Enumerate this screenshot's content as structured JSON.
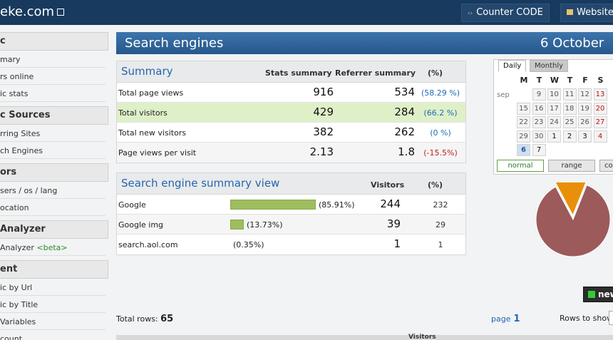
{
  "header": {
    "logo_text": "eke.com",
    "counter_code": "Counter CODE",
    "websites": "Website"
  },
  "sidebar": {
    "sections": [
      {
        "title": "c",
        "items": [
          "mary",
          "rs online",
          "ic stats"
        ]
      },
      {
        "title": "c Sources",
        "items": [
          "rring Sites",
          "ch Engines"
        ]
      },
      {
        "title": "ors",
        "items": [
          "sers / os / lang",
          "ocation"
        ]
      },
      {
        "title": "Analyzer",
        "items": [
          "Analyzer"
        ]
      },
      {
        "title": "ent",
        "items": [
          "ic by Url",
          "ic by Title",
          "Variables",
          "count"
        ]
      }
    ],
    "beta_label": "<beta>"
  },
  "main": {
    "title": "Search engines",
    "date": "6 October"
  },
  "summary": {
    "title": "Summary",
    "col_stats": "Stats summary",
    "col_referrer": "Referrer summary",
    "col_pct": "(%)",
    "rows": [
      {
        "label": "Total page views",
        "stats": "916",
        "referrer": "534",
        "pct": "(58.29 %)"
      },
      {
        "label": "Total visitors",
        "stats": "429",
        "referrer": "284",
        "pct": "(66.2 %)"
      },
      {
        "label": "Total new visitors",
        "stats": "382",
        "referrer": "262",
        "pct": "(0 %)"
      },
      {
        "label": "Page views per visit",
        "stats": "2.13",
        "referrer": "1.8",
        "pct": "(-15.5%)"
      }
    ]
  },
  "engines": {
    "title": "Search engine summary view",
    "col_visitors": "Visitors",
    "col_pct": "(%)",
    "rows": [
      {
        "name": "Google",
        "pct": "(85.91%)",
        "share": 0.8591,
        "visitors": "244",
        "count": "232"
      },
      {
        "name": "Google img",
        "pct": "(13.73%)",
        "share": 0.1373,
        "visitors": "39",
        "count": "29"
      },
      {
        "name": "search.aol.com",
        "pct": "(0.35%)",
        "share": 0.0035,
        "visitors": "1",
        "count": "1"
      }
    ]
  },
  "footer": {
    "total_rows_label": "Total rows:",
    "total_rows_value": "65",
    "page_label": "page",
    "page_value": "1",
    "rows_to_show": "Rows to show",
    "strip_label": "Visitors"
  },
  "calendar": {
    "tab_daily": "Daily",
    "tab_monthly": "Monthly",
    "dow": [
      "M",
      "T",
      "W",
      "T",
      "F",
      "S"
    ],
    "month_label": "sep",
    "weeks": [
      [
        "",
        "9",
        "10",
        "11",
        "12",
        "13"
      ],
      [
        "15",
        "16",
        "17",
        "18",
        "19",
        "20"
      ],
      [
        "22",
        "23",
        "24",
        "25",
        "26",
        "27"
      ],
      [
        "29",
        "30",
        "1",
        "2",
        "3",
        "4"
      ],
      [
        "6",
        "7",
        "",
        "",
        "",
        ""
      ]
    ],
    "btn_normal": "normal",
    "btn_range": "range",
    "btn_compare": "co"
  },
  "pie": {
    "slices": [
      {
        "value": 85.91,
        "color": "#9c5a5a"
      },
      {
        "value": 13.73,
        "color": "#e8900a"
      }
    ]
  },
  "new_button": "new"
}
